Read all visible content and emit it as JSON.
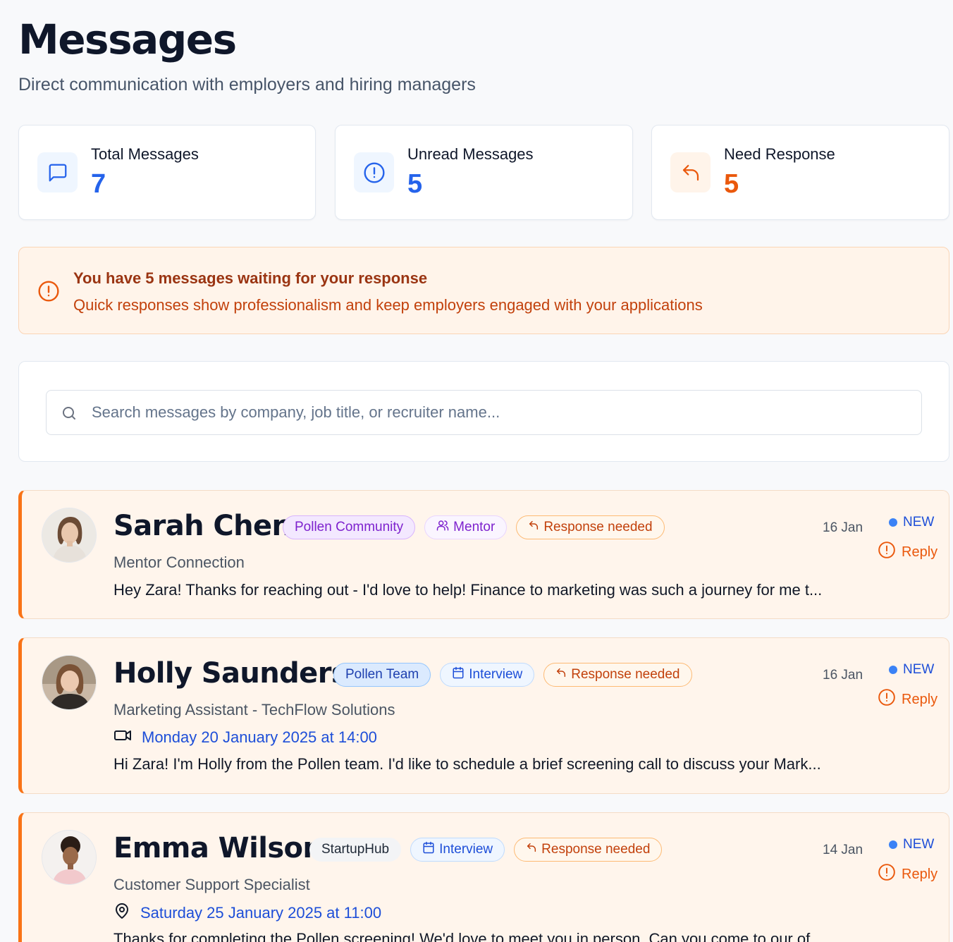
{
  "header": {
    "title": "Messages",
    "subtitle": "Direct communication with employers and hiring managers"
  },
  "stats": [
    {
      "label": "Total Messages",
      "value": "7",
      "icon": "message-square-icon",
      "color": "#2563eb"
    },
    {
      "label": "Unread Messages",
      "value": "5",
      "icon": "alert-circle-icon",
      "color": "#2563eb"
    },
    {
      "label": "Need Response",
      "value": "5",
      "icon": "reply-icon",
      "color": "#ea580c"
    }
  ],
  "alert": {
    "heading": "You have 5 messages waiting for your response",
    "text": "Quick responses show professionalism and keep employers engaged with your applications"
  },
  "search": {
    "placeholder": "Search messages by company, job title, or recruiter name...",
    "value": ""
  },
  "messages": [
    {
      "name": "Sarah Chen",
      "source_badge": "Pollen Community",
      "type_badge": "Mentor",
      "status_badge": "Response needed",
      "date": "16 Jan",
      "new_label": "NEW",
      "reply_label": "Reply",
      "role": "Mentor Connection",
      "preview": "Hey Zara! Thanks for reaching out - I'd love to help! Finance to marketing was such a journey for me t..."
    },
    {
      "name": "Holly Saunders",
      "source_badge": "Pollen Team",
      "type_badge": "Interview",
      "status_badge": "Response needed",
      "date": "16 Jan",
      "new_label": "NEW",
      "reply_label": "Reply",
      "role": "Marketing Assistant - TechFlow Solutions",
      "when": "Monday 20 January 2025 at 14:00",
      "when_icon": "video-icon",
      "preview": "Hi Zara! I'm Holly from the Pollen team. I'd like to schedule a brief screening call to discuss your Mark..."
    },
    {
      "name": "Emma Wilson",
      "source_badge": "StartupHub",
      "type_badge": "Interview",
      "status_badge": "Response needed",
      "date": "14 Jan",
      "new_label": "NEW",
      "reply_label": "Reply",
      "role": "Customer Support Specialist",
      "when": "Saturday 25 January 2025 at 11:00",
      "when_icon": "map-pin-icon",
      "preview": "Thanks for completing the Pollen screening! We'd love to meet you in person. Can you come to our of..."
    }
  ]
}
